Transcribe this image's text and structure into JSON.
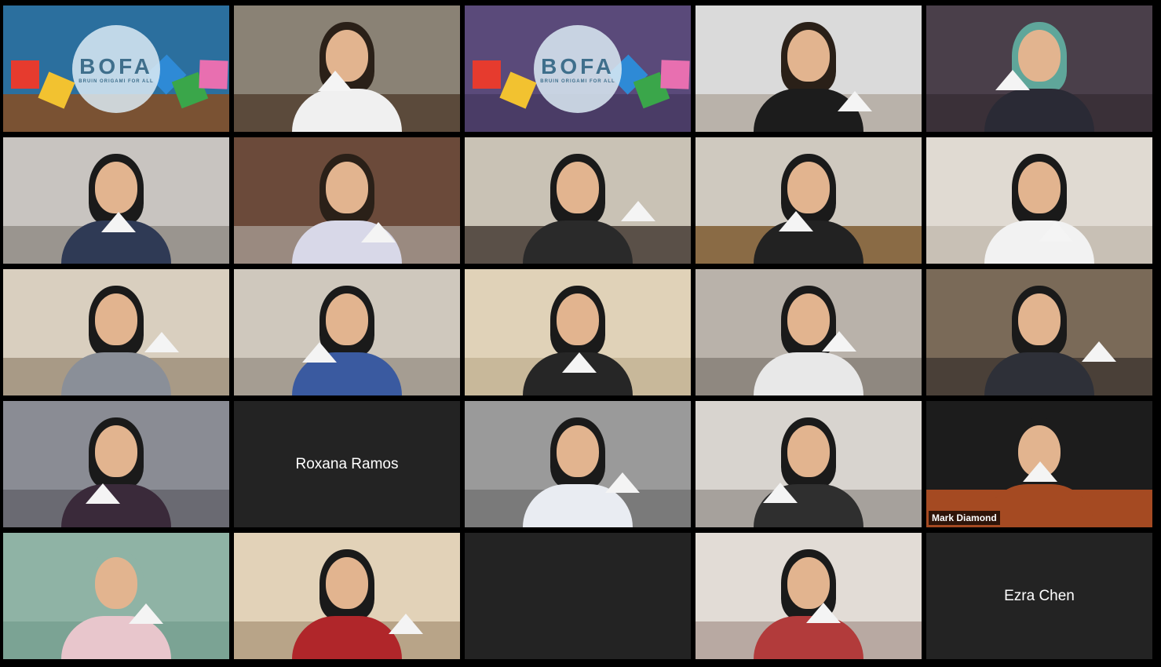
{
  "meeting": {
    "participants": [
      {
        "kind": "image",
        "label": "bofa-logo-tile",
        "logo_text": "BOFA",
        "logo_subtext": "BRUIN ORIGAMI FOR ALL",
        "wall": "#2b6f9e",
        "floor": "#7a5233"
      },
      {
        "kind": "video",
        "label": "participant-2",
        "wall": "#8a8275",
        "floor": "#5b4a3b",
        "shirt": "#f0f0f0",
        "hair": "#2a2018"
      },
      {
        "kind": "image",
        "label": "bofa-logo-tile-2",
        "logo_text": "BOFA",
        "logo_subtext": "BRUIN ORIGAMI FOR ALL",
        "wall": "#5a4a7a",
        "floor": "#4a3c66"
      },
      {
        "kind": "video",
        "label": "participant-4",
        "wall": "#dadada",
        "floor": "#b9b2aa",
        "shirt": "#1c1c1c",
        "hair": "#2a2018"
      },
      {
        "kind": "video",
        "label": "participant-5",
        "wall": "#4a3f4a",
        "floor": "#3a3038",
        "shirt": "#2a2a35",
        "hair": "#5fa69a"
      },
      {
        "kind": "video",
        "label": "participant-6",
        "wall": "#c8c4c0",
        "floor": "#9a958f",
        "shirt": "#2f3a55",
        "hair": "#1a1a1a"
      },
      {
        "kind": "video",
        "label": "participant-7",
        "wall": "#6b4a3a",
        "floor": "#9a8a80",
        "shirt": "#d8d8e8",
        "hair": "#2a2018"
      },
      {
        "kind": "video",
        "label": "participant-8",
        "wall": "#c9c2b5",
        "floor": "#5a5048",
        "shirt": "#2a2a2a",
        "hair": "#1a1a1a"
      },
      {
        "kind": "video",
        "label": "participant-9",
        "wall": "#cfc9bf",
        "floor": "#8a6b45",
        "shirt": "#222222",
        "hair": "#1a1a1a"
      },
      {
        "kind": "video",
        "label": "participant-10",
        "wall": "#e0dad2",
        "floor": "#c8c0b5",
        "shirt": "#f2f2f2",
        "hair": "#1a1a1a"
      },
      {
        "kind": "video",
        "label": "participant-11",
        "wall": "#d9cfbf",
        "floor": "#a89a86",
        "shirt": "#8a8f98",
        "hair": "#1a1a1a"
      },
      {
        "kind": "video",
        "label": "participant-12",
        "wall": "#cfc8bd",
        "floor": "#a59d92",
        "shirt": "#3a5aa0",
        "hair": "#1a1a1a"
      },
      {
        "kind": "video",
        "label": "participant-13",
        "wall": "#e0d2b8",
        "floor": "#c8b89a",
        "shirt": "#262626",
        "hair": "#1a1a1a"
      },
      {
        "kind": "video",
        "label": "participant-14",
        "wall": "#b9b2aa",
        "floor": "#8f8880",
        "shirt": "#e8e8e8",
        "hair": "#1a1a1a"
      },
      {
        "kind": "video",
        "label": "participant-15",
        "wall": "#7a6a58",
        "floor": "#4a4038",
        "shirt": "#2e3038",
        "hair": "#1a1a1a"
      },
      {
        "kind": "video",
        "label": "participant-16",
        "wall": "#8a8c94",
        "floor": "#6a6a72",
        "shirt": "#3a2a3a",
        "hair": "#1a1a1a"
      },
      {
        "kind": "name",
        "label": "participant-roxana",
        "name": "Roxana Ramos"
      },
      {
        "kind": "video",
        "label": "participant-18",
        "wall": "#9a9a9a",
        "floor": "#7a7a7a",
        "shirt": "#e9ecf2",
        "hair": "#1a1a1a"
      },
      {
        "kind": "video",
        "label": "participant-19",
        "wall": "#d8d4cf",
        "floor": "#a6a19c",
        "shirt": "#2f2f2f",
        "hair": "#1a1a1a"
      },
      {
        "kind": "video",
        "label": "participant-mark",
        "name_tag": "Mark Diamond",
        "wall": "#1c1c1c",
        "floor": "#a54a22",
        "shirt": "#a54a22",
        "hair": "#1c1c1c",
        "active": true
      },
      {
        "kind": "video",
        "label": "participant-21",
        "wall": "#8fb3a5",
        "floor": "#7ba394",
        "shirt": "#e8c6cc",
        "hair": "#8fb3a5"
      },
      {
        "kind": "video",
        "label": "participant-22",
        "wall": "#e2d2b8",
        "floor": "#b8a488",
        "shirt": "#b0262a",
        "hair": "#1a1a1a"
      },
      {
        "kind": "empty",
        "label": "empty-tile"
      },
      {
        "kind": "video",
        "label": "participant-24",
        "wall": "#e2dcd6",
        "floor": "#b8a9a2",
        "shirt": "#b23b3b",
        "hair": "#1a1a1a"
      },
      {
        "kind": "name",
        "label": "participant-ezra",
        "name": "Ezra Chen"
      }
    ]
  }
}
